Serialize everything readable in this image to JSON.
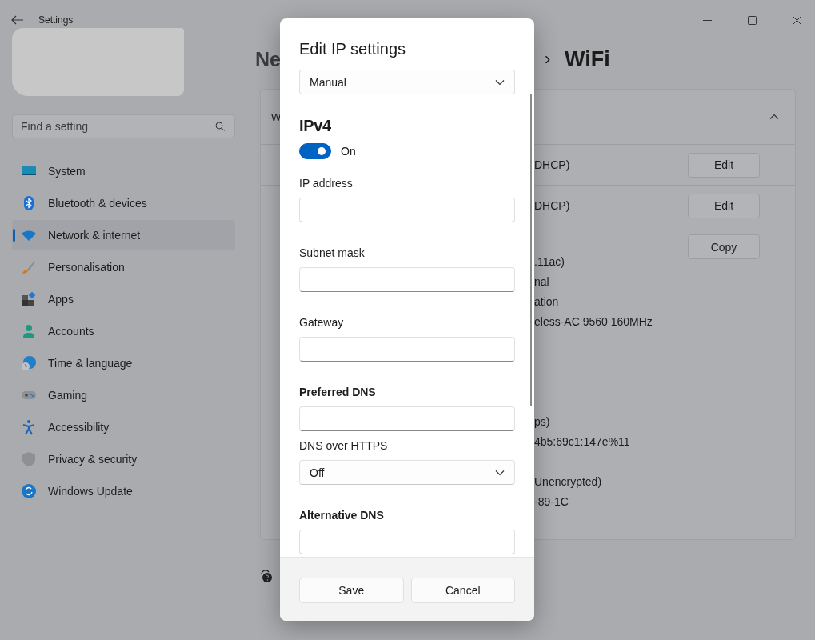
{
  "window": {
    "title": "Settings"
  },
  "search": {
    "placeholder": "Find a setting"
  },
  "sidebar": {
    "items": [
      {
        "label": "System",
        "selected": false
      },
      {
        "label": "Bluetooth & devices",
        "selected": false
      },
      {
        "label": "Network & internet",
        "selected": true
      },
      {
        "label": "Personalisation",
        "selected": false
      },
      {
        "label": "Apps",
        "selected": false
      },
      {
        "label": "Accounts",
        "selected": false
      },
      {
        "label": "Time & language",
        "selected": false
      },
      {
        "label": "Gaming",
        "selected": false
      },
      {
        "label": "Accessibility",
        "selected": false
      },
      {
        "label": "Privacy & security",
        "selected": false
      },
      {
        "label": "Windows Update",
        "selected": false
      }
    ]
  },
  "breadcrumb": [
    "Ne",
    "›",
    "WiFi"
  ],
  "card": {
    "header": "W",
    "expanded": true,
    "rows": [
      {
        "value": "DHCP)",
        "button": "Edit"
      },
      {
        "value": "DHCP)",
        "button": "Edit"
      }
    ],
    "details": {
      "button": "Copy",
      "groups": [
        [
          ".11ac)",
          "nal",
          "ation",
          "eless-AC 9560 160MHz"
        ],
        [
          "ps)",
          "4b5:69c1:147e%11"
        ],
        [
          "Unencrypted)",
          "-89-1C"
        ]
      ]
    }
  },
  "dialog": {
    "title": "Edit IP settings",
    "mode": "Manual",
    "section": "IPv4",
    "toggle": {
      "on": true,
      "label": "On"
    },
    "fields": [
      {
        "kind": "text",
        "label": "IP address",
        "strong": false
      },
      {
        "kind": "text",
        "label": "Subnet mask",
        "strong": false
      },
      {
        "kind": "text",
        "label": "Gateway",
        "strong": false
      },
      {
        "kind": "text",
        "label": "Preferred DNS",
        "strong": true
      },
      {
        "kind": "select",
        "label": "DNS over HTTPS",
        "strong": false,
        "value": "Off"
      },
      {
        "kind": "text",
        "label": "Alternative DNS",
        "strong": true
      }
    ],
    "buttons": [
      "Save",
      "Cancel"
    ]
  }
}
